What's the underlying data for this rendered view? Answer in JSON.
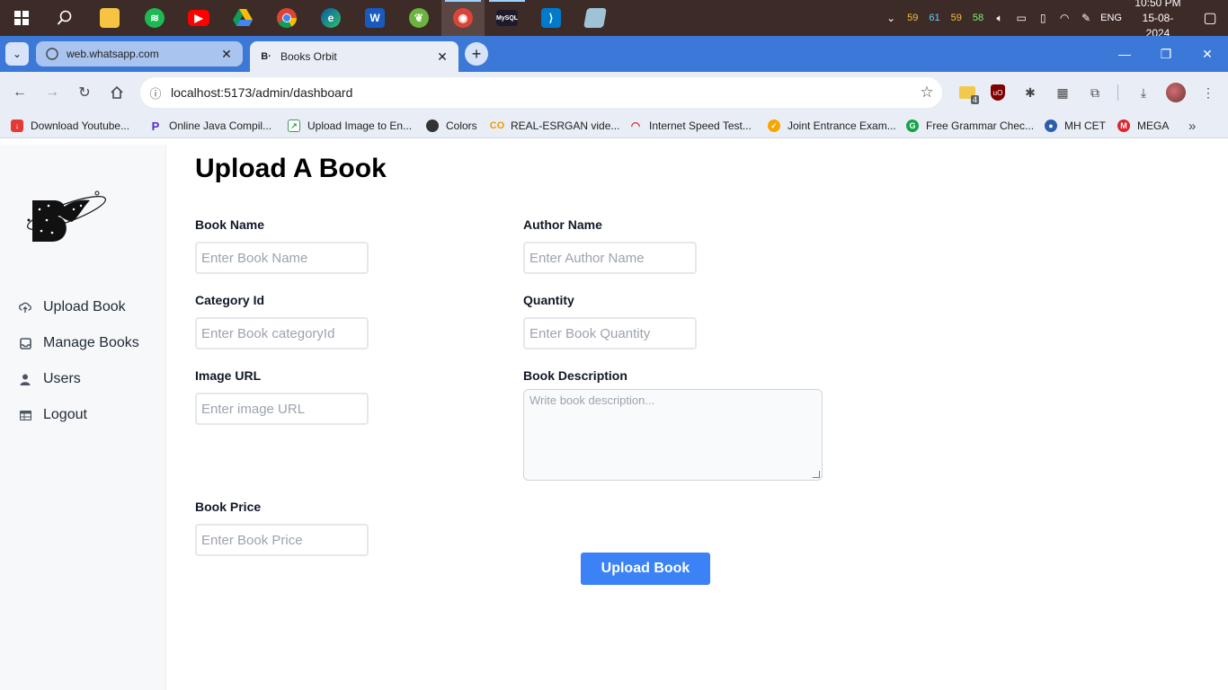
{
  "taskbar": {
    "stats": [
      "59",
      "61",
      "59",
      "58"
    ],
    "language": "ENG",
    "time": "10:50 PM",
    "date": "15-08-2024"
  },
  "browser": {
    "tabs": [
      {
        "title": "web.whatsapp.com",
        "active": false
      },
      {
        "title": "Books Orbit",
        "active": true
      }
    ],
    "url": "localhost:5173/admin/dashboard",
    "extension_badge": "4",
    "bookmarks": [
      "Download Youtube...",
      "Online Java Compil...",
      "Upload Image to En...",
      "Colors",
      "REAL-ESRGAN vide...",
      "Internet Speed Test...",
      "Joint Entrance Exam...",
      "Free Grammar Chec...",
      "MH CET",
      "MEGA"
    ]
  },
  "sidebar": {
    "items": [
      {
        "label": "Upload Book",
        "icon": "upload-icon"
      },
      {
        "label": "Manage Books",
        "icon": "inbox-icon"
      },
      {
        "label": "Users",
        "icon": "user-icon"
      },
      {
        "label": "Logout",
        "icon": "table-icon"
      }
    ]
  },
  "form": {
    "title": "Upload A Book",
    "book_name": {
      "label": "Book Name",
      "placeholder": "Enter Book Name"
    },
    "author_name": {
      "label": "Author Name",
      "placeholder": "Enter Author Name"
    },
    "category_id": {
      "label": "Category Id",
      "placeholder": "Enter Book categoryId"
    },
    "quantity": {
      "label": "Quantity",
      "placeholder": "Enter Book Quantity"
    },
    "image_url": {
      "label": "Image URL",
      "placeholder": "Enter image URL"
    },
    "description": {
      "label": "Book Description",
      "placeholder": "Write book description..."
    },
    "price": {
      "label": "Book Price",
      "placeholder": "Enter Book Price"
    },
    "submit_label": "Upload Book"
  },
  "colors": {
    "primary_button": "#3b82f6",
    "tab_strip": "#3b78d8",
    "taskbar": "#3d2b28"
  }
}
